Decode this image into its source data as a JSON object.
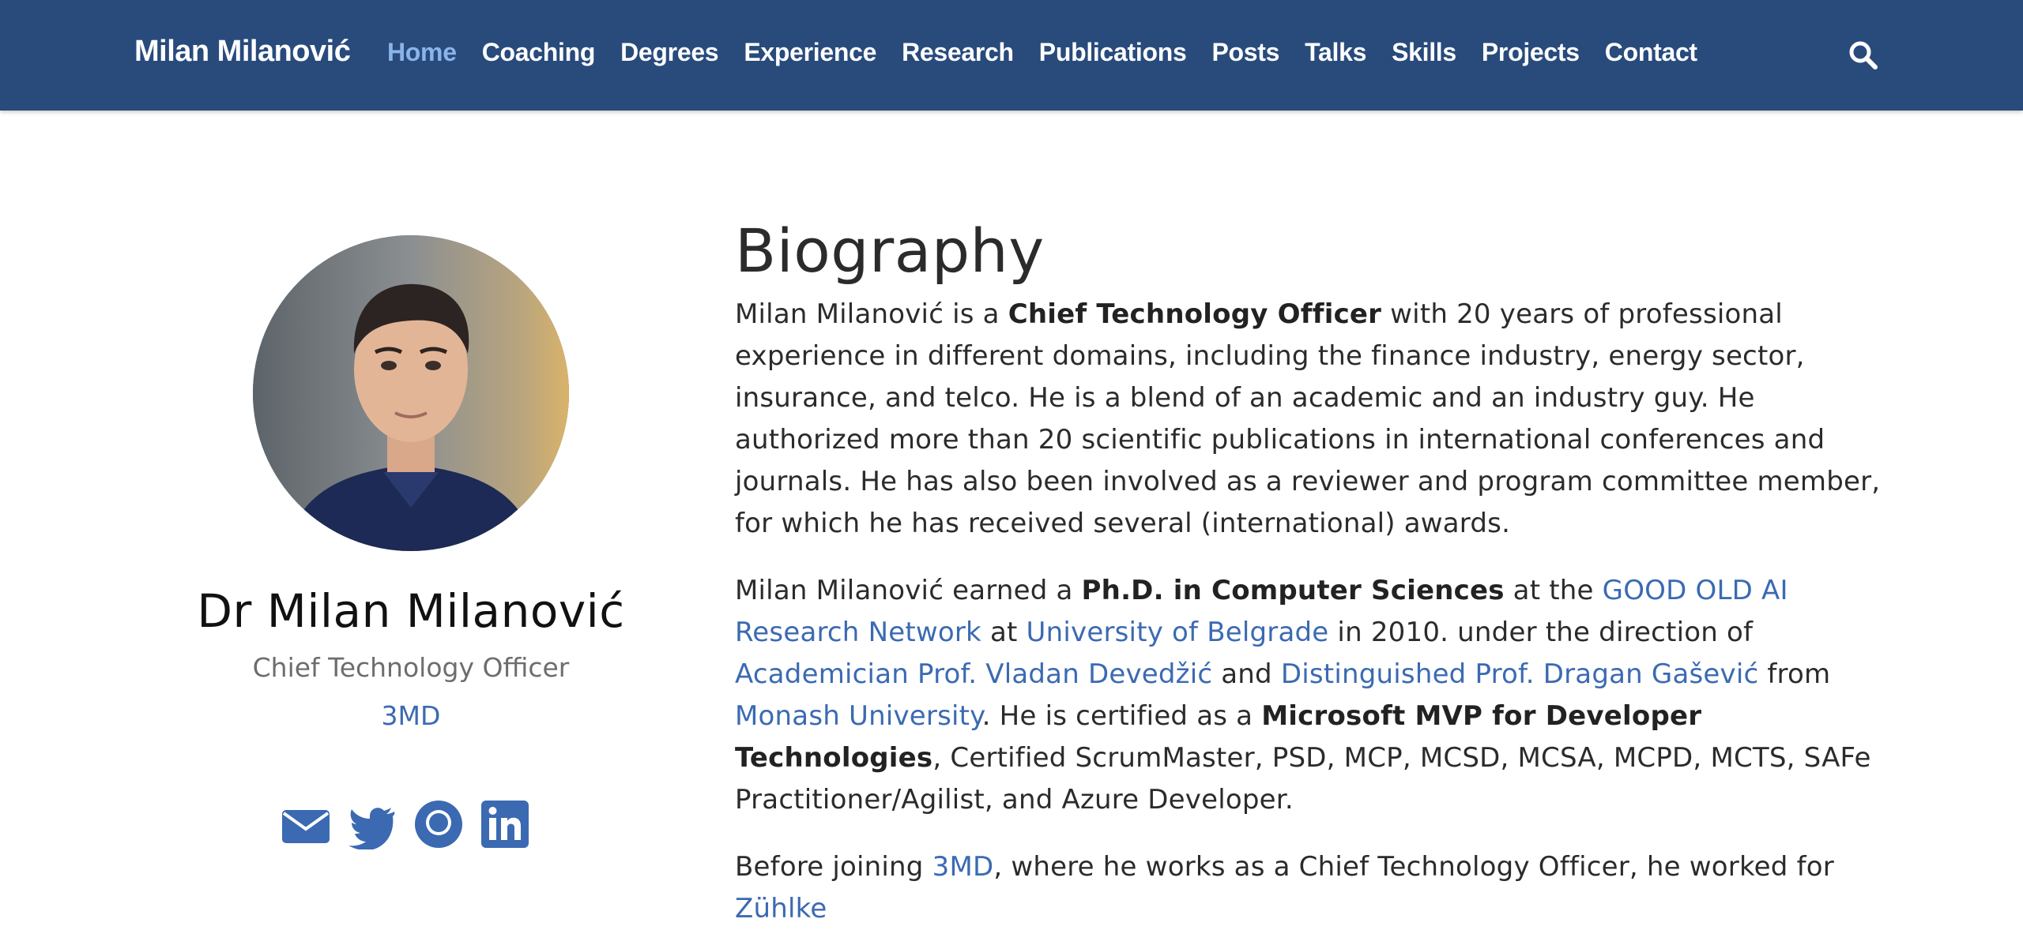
{
  "navbar": {
    "brand": "Milan Milanović",
    "links": [
      "Home",
      "Coaching",
      "Degrees",
      "Experience",
      "Research",
      "Publications",
      "Posts",
      "Talks",
      "Skills",
      "Projects",
      "Contact"
    ],
    "active": "Home",
    "search_icon": "search-icon"
  },
  "profile": {
    "name": "Dr Milan Milanović",
    "role": "Chief Technology Officer",
    "organization": "3MD",
    "social_icons": [
      "envelope-icon",
      "twitter-icon",
      "github-icon",
      "linkedin-icon"
    ]
  },
  "biography": {
    "title": "Biography",
    "p1": {
      "t1": "Milan Milanović is a ",
      "b1": "Chief Technology Officer",
      "t2": " with 20 years of professional experience in different domains, including the finance industry, energy sector, insurance, and telco. He is a blend of an academic and an industry guy. He authorized more than 20 scientific publications in international conferences and journals. He has also been involved as a reviewer and program committee member, for which he has received several (international) awards."
    },
    "p2": {
      "t1": "Milan Milanović earned a ",
      "b1": "Ph.D. in Computer Sciences",
      "t2": " at the ",
      "l1": "GOOD OLD AI Research Network",
      "t3": " at ",
      "l2": "University of Belgrade",
      "t4": " in 2010. under the direction of ",
      "l3": "Academician Prof. Vladan Devedžić",
      "t5": " and ",
      "l4": "Distinguished Prof. Dragan Gašević",
      "t6": " from ",
      "l5": "Monash University",
      "t7": ". He is certified as a ",
      "b2": "Microsoft MVP for Developer Technologies",
      "t8": ", Certified ScrumMaster, PSD, MCP, MCSD, MCSA, MCPD, MCTS, SAFe Practitioner/Agilist, and Azure Developer."
    },
    "p3": {
      "t1": "Before joining ",
      "l1": "3MD",
      "t2": ", where he works as a Chief Technology Officer, he worked for ",
      "l2": "Zühlke"
    }
  },
  "colors": {
    "navbar_bg": "#284b7c",
    "nav_active": "#8ab4ea",
    "link": "#3b6ab2",
    "text": "#2b2b2b",
    "muted": "#6d6d6d"
  }
}
